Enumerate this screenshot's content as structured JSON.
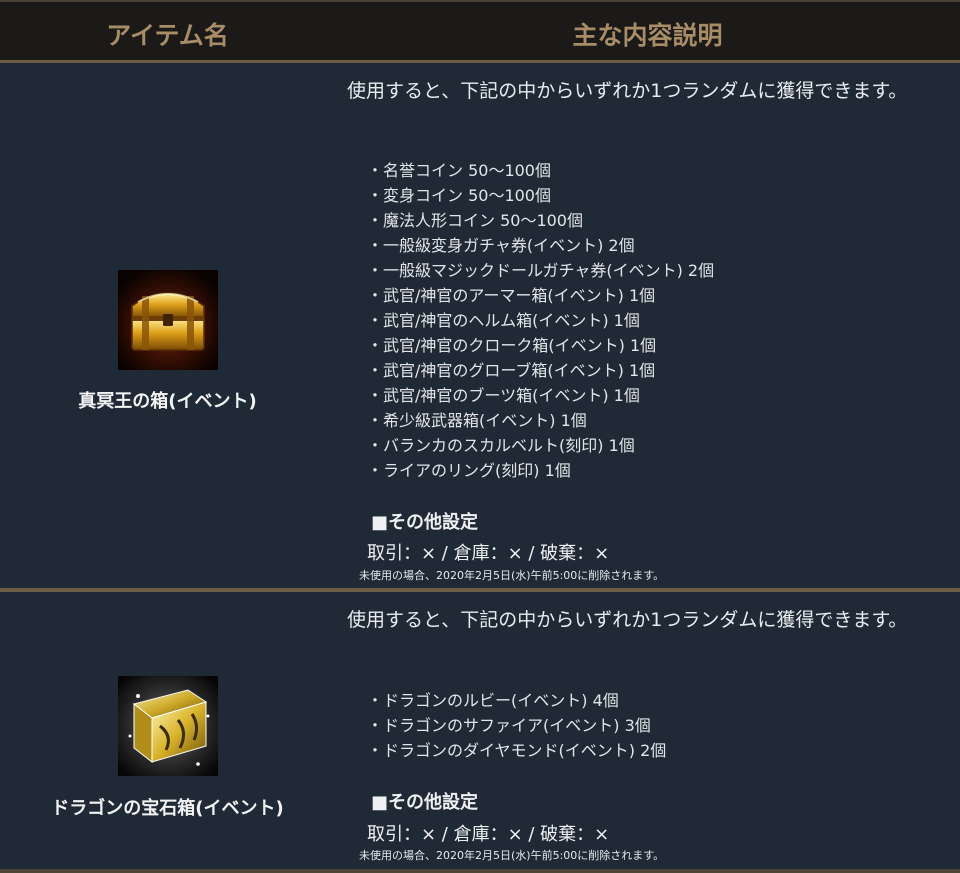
{
  "header": {
    "col_item": "アイテム名",
    "col_desc": "主な内容説明"
  },
  "rows": [
    {
      "name": "真冥王の箱(イベント)",
      "intro": "使用すると、下記の中からいずれか1つランダムに獲得できます。",
      "items": [
        "・名誉コイン 50～100個",
        "・変身コイン 50～100個",
        "・魔法人形コイン 50～100個",
        "・一般級変身ガチャ券(イベント) 2個",
        "・一般級マジックドールガチャ券(イベント) 2個",
        "・武官/神官のアーマー箱(イベント) 1個",
        "・武官/神官のヘルム箱(イベント) 1個",
        "・武官/神官のクローク箱(イベント) 1個",
        "・武官/神官のグローブ箱(イベント) 1個",
        "・武官/神官のブーツ箱(イベント) 1個",
        "・希少級武器箱(イベント) 1個",
        "・バランカのスカルベルト(刻印) 1個",
        "・ライアのリング(刻印) 1個"
      ],
      "other_title": "■その他設定",
      "settings": "取引：× / 倉庫：× / 破棄：×",
      "note": "未使用の場合、2020年2月5日(水)午前5:00に削除されます。",
      "icon": "golden-chest-icon"
    },
    {
      "name": "ドラゴンの宝石箱(イベント)",
      "intro": "使用すると、下記の中からいずれか1つランダムに獲得できます。",
      "items": [
        "・ドラゴンのルビー(イベント) 4個",
        "・ドラゴンのサファイア(イベント) 3個",
        "・ドラゴンのダイヤモンド(イベント) 2個"
      ],
      "other_title": "■その他設定",
      "settings": "取引：× / 倉庫：× / 破棄：×",
      "note": "未使用の場合、2020年2月5日(水)午前5:00に削除されます。",
      "icon": "dragon-jewel-box-icon"
    }
  ],
  "colors": {
    "background": "#1f2a36",
    "header_background": "#1b1a18",
    "header_text": "#a78c66",
    "separator": "#6e5c47"
  }
}
